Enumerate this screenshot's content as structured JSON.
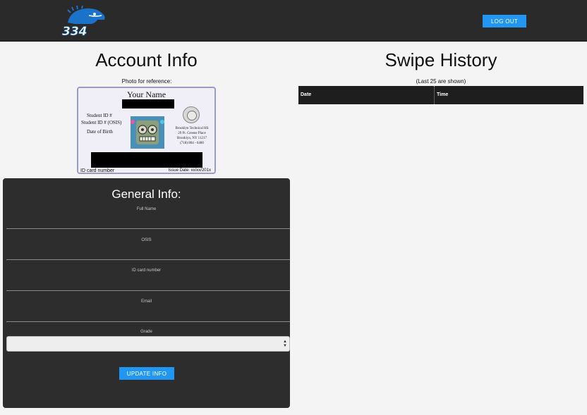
{
  "header": {
    "logo_text": "334",
    "logout_label": "LOG OUT"
  },
  "account": {
    "title": "Account Info",
    "photo_caption": "Photo for reference:",
    "id_card": {
      "name": "Your Name",
      "student_id_label": "Student ID #",
      "osis_label": "Student ID # (OSIS)",
      "dob_label": "Date of Birth",
      "school_lines": [
        "Brooklyn Technical HS",
        "29 Ft. Greene Place",
        "Brooklyn, NY 11217",
        "(718) 804 - 6400"
      ],
      "id_card_number_label": "ID card number",
      "issue_date": "Issue Date: xx/xx/201x"
    }
  },
  "general_info": {
    "title": "General Info:",
    "fields": [
      {
        "label": "Full Name",
        "value": ""
      },
      {
        "label": "OSIS",
        "value": ""
      },
      {
        "label": "ID card number",
        "value": ""
      },
      {
        "label": "Email",
        "value": ""
      }
    ],
    "grade_label": "Grade",
    "grade_value": "",
    "update_label": "UPDATE INFO"
  },
  "swipe_history": {
    "title": "Swipe History",
    "note": "(Last 25 are shown)",
    "columns": [
      "Date",
      "Time"
    ],
    "rows": []
  },
  "colors": {
    "accent": "#2196f3",
    "bar": "#2a2a2a",
    "panel": "#2d2d2d",
    "logo_blue": "#1a73c9"
  },
  "icons": {
    "logo": "eagle-334-logo",
    "robot": "robot-photo",
    "seal": "school-seal-icon",
    "select_arrows": "updown-arrows-icon"
  }
}
